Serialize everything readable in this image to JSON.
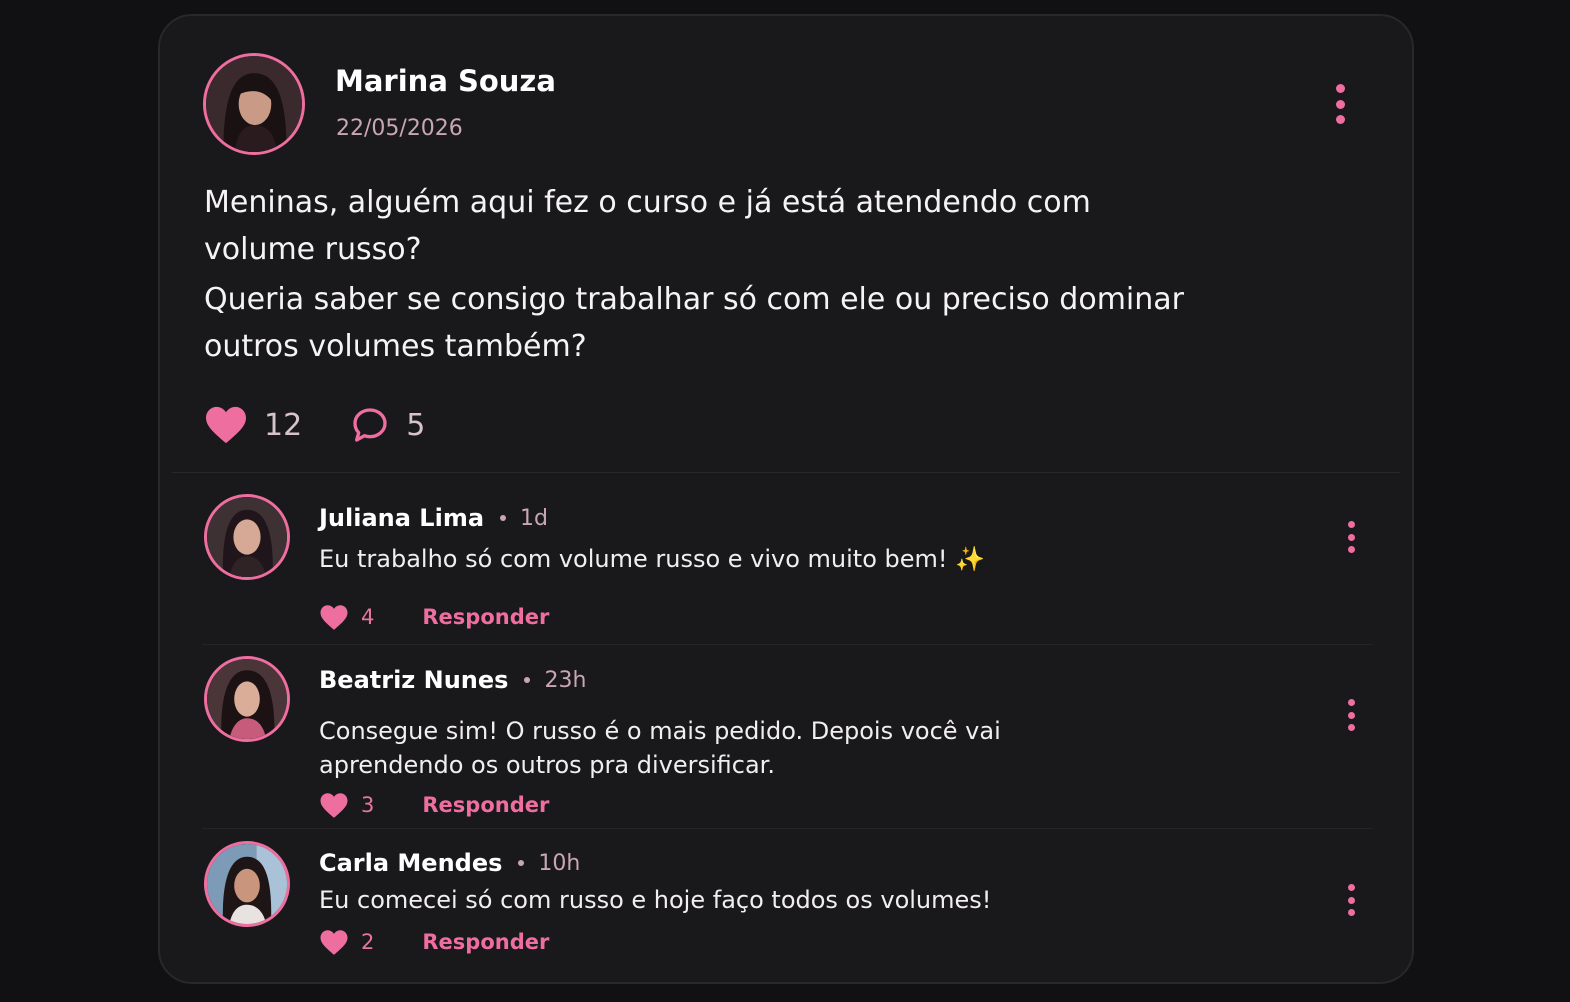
{
  "post": {
    "author": "Marina Souza",
    "date": "22/05/2026",
    "paragraphs": [
      "Meninas, alguém aqui fez o curso e já está atendendo com volume russo?",
      "Queria saber se consigo trabalhar só com ele ou preciso dominar outros volumes também?"
    ],
    "likes": "12",
    "comments": "5",
    "avatar_icon": "avatar-marina-souza"
  },
  "comments": [
    {
      "author": "Juliana Lima",
      "time": "1d",
      "text": "Eu trabalho só com volume russo e vivo muito bem!",
      "emoji": "✨",
      "likes": "4",
      "reply_label": "Responder"
    },
    {
      "author": "Beatriz Nunes",
      "time": "23h",
      "text": "Consegue sim! O russo é o mais pedido. Depois você vai aprendendo os outros pra diversificar.",
      "likes": "3",
      "reply_label": "Responder"
    },
    {
      "author": "Carla Mendes",
      "time": "10h",
      "text": "Eu comecei só com russo e hoje faço todos os volumes!",
      "likes": "2",
      "reply_label": "Responder"
    }
  ],
  "colors": {
    "accent": "#ef6ea0",
    "background": "#111113",
    "card": "#19181a",
    "muted": "#c9a6b3"
  }
}
